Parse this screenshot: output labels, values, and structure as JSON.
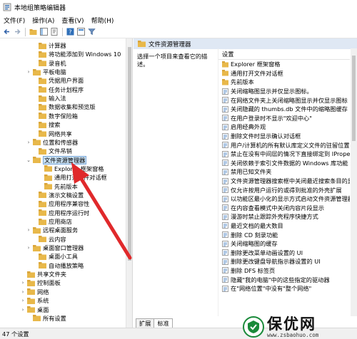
{
  "window": {
    "title": "本地组策略编辑器"
  },
  "menu": [
    {
      "label": "文件(F)"
    },
    {
      "label": "操作(A)"
    },
    {
      "label": "查看(V)"
    },
    {
      "label": "帮助(H)"
    }
  ],
  "tree": {
    "items": [
      {
        "label": "计算器",
        "expander": ""
      },
      {
        "label": "将功能添加到 Windows 10",
        "expander": ""
      },
      {
        "label": "录音机",
        "expander": ""
      },
      {
        "label": "平板电脑",
        "expander": "›"
      },
      {
        "label": "凭据用户界面",
        "expander": ""
      },
      {
        "label": "任务计划程序",
        "expander": ""
      },
      {
        "label": "输入法",
        "expander": ""
      },
      {
        "label": "数据收集和预览版",
        "expander": ""
      },
      {
        "label": "数字保险箱",
        "expander": ""
      },
      {
        "label": "搜索",
        "expander": ""
      },
      {
        "label": "网络共享",
        "expander": ""
      },
      {
        "label": "位置和传感器",
        "expander": "›"
      },
      {
        "label": "文件吊销",
        "expander": ""
      },
      {
        "label": "文件资源管理器",
        "expander": "⌄",
        "selected": true
      },
      {
        "label": "Explorer 框架窗格",
        "expander": ""
      },
      {
        "label": "通用打开文件对话框",
        "expander": ""
      },
      {
        "label": "先前版本",
        "expander": ""
      },
      {
        "label": "演示文稿设置",
        "expander": ""
      },
      {
        "label": "应用程序兼容性",
        "expander": ""
      },
      {
        "label": "应用程序运行时",
        "expander": ""
      },
      {
        "label": "应用商店",
        "expander": ""
      },
      {
        "label": "远程桌面服务",
        "expander": "›"
      },
      {
        "label": "云内容",
        "expander": ""
      },
      {
        "label": "桌面窗口管理器",
        "expander": "›"
      },
      {
        "label": "桌面小工具",
        "expander": ""
      },
      {
        "label": "自动播放策略",
        "expander": ""
      },
      {
        "label": "共享文件夹",
        "expander": ""
      },
      {
        "label": "控制面板",
        "expander": "›"
      },
      {
        "label": "网络",
        "expander": "›"
      },
      {
        "label": "系统",
        "expander": "›"
      },
      {
        "label": "桌面",
        "expander": "›"
      },
      {
        "label": "所有设置",
        "expander": ""
      }
    ]
  },
  "content": {
    "header": "文件资源管理器",
    "description": "选择一个项目来查看它的描述。",
    "column_header": "设置",
    "settings": [
      {
        "label": "Explorer 框架窗格",
        "icon": "folder"
      },
      {
        "label": "通用打开文件对话框",
        "icon": "folder"
      },
      {
        "label": "先前版本",
        "icon": "folder"
      },
      {
        "label": "关闭缩略图显示并仅显示图标。",
        "icon": "setting"
      },
      {
        "label": "在网络文件夹上关闭缩略图显示并仅显示图标",
        "icon": "setting"
      },
      {
        "label": "关闭隐藏的 thumbs.db 文件中的缩略图缓存",
        "icon": "setting"
      },
      {
        "label": "在用户登录时不显示\"欢迎中心\"",
        "icon": "setting"
      },
      {
        "label": "启用经典外观",
        "icon": "setting"
      },
      {
        "label": "删除文件时显示确认对话框",
        "icon": "setting"
      },
      {
        "label": "用户/计算机的所有默认库定义文件的驻留位置",
        "icon": "setting"
      },
      {
        "label": "禁止在没有中间层的情况下直接绑定到 IPropertyS",
        "icon": "setting"
      },
      {
        "label": "关闭依赖于索引文件数据的 Windows 库功能",
        "icon": "setting"
      },
      {
        "label": "禁用已知文件夹",
        "icon": "setting"
      },
      {
        "label": "文件资源管理器搜索框中关闭最近搜索条目的显示",
        "icon": "setting"
      },
      {
        "label": "仅允许按用户运行的或得到批准的外壳扩展",
        "icon": "setting"
      },
      {
        "label": "以功能区最小化的显示方式启动文件资源管理器",
        "icon": "setting"
      },
      {
        "label": "在内容查看模式中关闭内容片段显示",
        "icon": "setting"
      },
      {
        "label": "漫游时禁止跟踪外壳程序快捷方式",
        "icon": "setting"
      },
      {
        "label": "最近文档的最大数目",
        "icon": "setting"
      },
      {
        "label": "删除 CD 刻录功能",
        "icon": "setting"
      },
      {
        "label": "关闭缩略图的缓存",
        "icon": "setting"
      },
      {
        "label": "删除更改菜单动画设置的 UI",
        "icon": "setting"
      },
      {
        "label": "删除更改键盘导航指示器设置的 UI",
        "icon": "setting"
      },
      {
        "label": "删除 DFS 标签页",
        "icon": "setting"
      },
      {
        "label": "隐藏\"我的电脑\"中的这些指定的驱动器",
        "icon": "setting"
      },
      {
        "label": "在\"网络位置\"中没有\"整个网络\"",
        "icon": "setting"
      }
    ]
  },
  "tabs": [
    {
      "label": "扩展"
    },
    {
      "label": "标准"
    }
  ],
  "status": {
    "text": "47 个设置"
  },
  "watermark": {
    "brand": "保优网",
    "url": "www.zsbaohuo.com"
  },
  "colors": {
    "selection": "#cce4f7",
    "folder": "#e8b84a",
    "arrow": "#e0292b",
    "header_strip": "#dfe8f4"
  }
}
